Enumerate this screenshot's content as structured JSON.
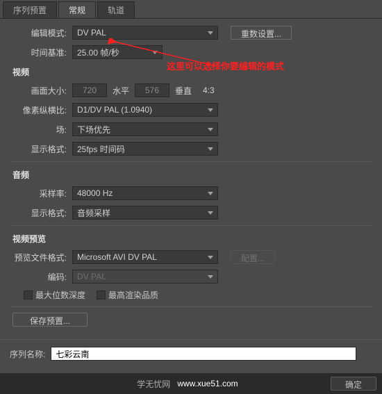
{
  "tabs": {
    "preset": "序列预置",
    "general": "常规",
    "tracks": "轨道"
  },
  "general": {
    "editMode_label": "编辑模式:",
    "editMode_value": "DV PAL",
    "resetBtn": "重数设置...",
    "timebase_label": "时间基准:",
    "timebase_value": "25.00 帧/秒"
  },
  "video": {
    "section": "视频",
    "frameSize_label": "画面大小:",
    "width": "720",
    "h_label": "水平",
    "height": "576",
    "v_label": "垂直",
    "aspect": "4:3",
    "pixelAspect_label": "像素纵横比:",
    "pixelAspect_value": "D1/DV PAL (1.0940)",
    "fields_label": "场:",
    "fields_value": "下场优先",
    "displayFormat_label": "显示格式:",
    "displayFormat_value": "25fps 时间码"
  },
  "audio": {
    "section": "音频",
    "sampleRate_label": "采样率:",
    "sampleRate_value": "48000 Hz",
    "displayFormat_label": "显示格式:",
    "displayFormat_value": "音频采样"
  },
  "preview": {
    "section": "视频预览",
    "fileFormat_label": "预览文件格式:",
    "fileFormat_value": "Microsoft AVI DV PAL",
    "configBtn": "配置...",
    "codec_label": "编码:",
    "codec_value": "DV PAL",
    "maxBitDepth": "最大位数深度",
    "maxRenderQuality": "最高渲染品质"
  },
  "savePresetBtn": "保存预置...",
  "seqName_label": "序列名称:",
  "seqName_value": "七彩云南",
  "confirmBtn": "确定",
  "annotation": "这里可以选择你要编辑的模式",
  "watermark_text": "学无忧网",
  "watermark_url": "www.xue51.com"
}
